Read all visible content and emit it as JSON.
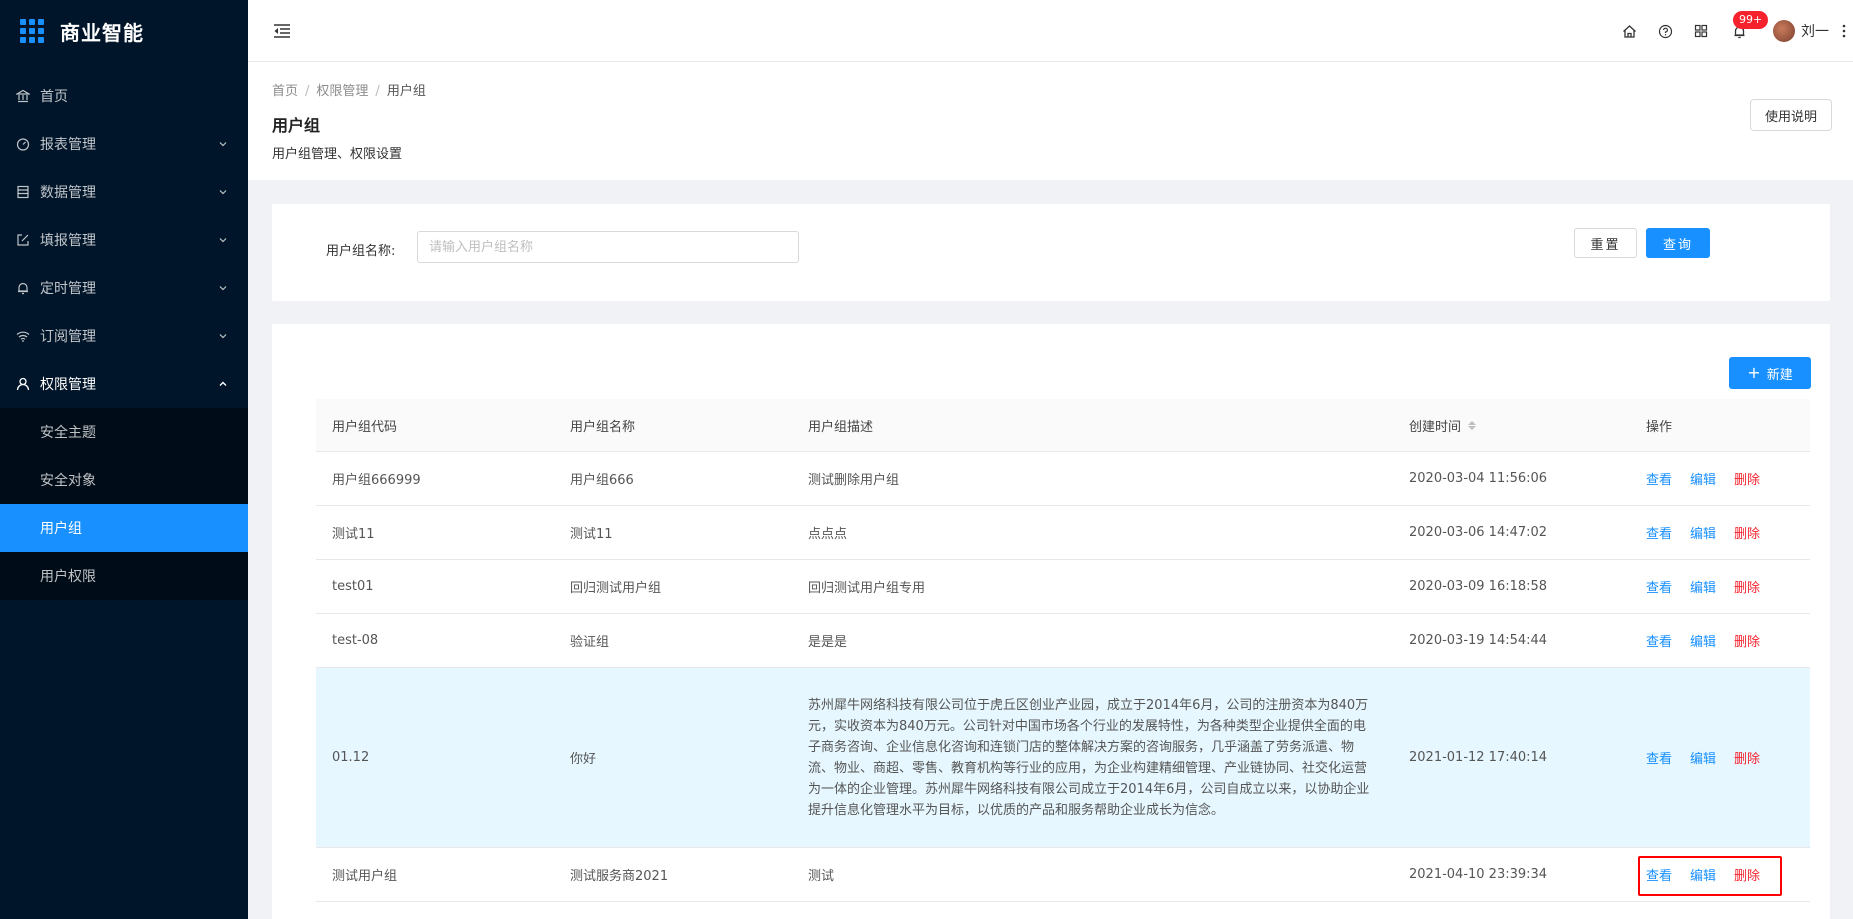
{
  "app": {
    "logo_text": "商业智能"
  },
  "sidebar": {
    "items": [
      {
        "label": "首页",
        "icon": "bank-icon"
      },
      {
        "label": "报表管理",
        "icon": "dashboard-icon"
      },
      {
        "label": "数据管理",
        "icon": "database-icon"
      },
      {
        "label": "填报管理",
        "icon": "form-edit-icon"
      },
      {
        "label": "定时管理",
        "icon": "bell-icon"
      },
      {
        "label": "订阅管理",
        "icon": "wifi-icon"
      },
      {
        "label": "权限管理",
        "icon": "user-icon"
      }
    ],
    "submenu": [
      "安全主题",
      "安全对象",
      "用户组",
      "用户权限"
    ],
    "active_sub": "用户组"
  },
  "header": {
    "badge": "99+",
    "user_name": "刘一"
  },
  "breadcrumb": [
    "首页",
    "权限管理",
    "用户组"
  ],
  "page": {
    "title": "用户组",
    "description": "用户组管理、权限设置",
    "help_button": "使用说明"
  },
  "search": {
    "label": "用户组名称:",
    "placeholder": "请输入用户组名称",
    "value": "",
    "reset_label": "重置",
    "query_label": "查询"
  },
  "table": {
    "new_label": "新建",
    "columns": [
      "用户组代码",
      "用户组名称",
      "用户组描述",
      "创建时间",
      "操作"
    ],
    "actions": {
      "view": "查看",
      "edit": "编辑",
      "delete": "删除"
    },
    "rows": [
      {
        "code": "用户组666999",
        "name": "用户组666",
        "desc": "测试删除用户组",
        "created": "2020-03-04 11:56:06"
      },
      {
        "code": "测试11",
        "name": "测试11",
        "desc": "点点点",
        "created": "2020-03-06 14:47:02"
      },
      {
        "code": "test01",
        "name": "回归测试用户组",
        "desc": "回归测试用户组专用",
        "created": "2020-03-09 16:18:58"
      },
      {
        "code": "test-08",
        "name": "验证组",
        "desc": "是是是",
        "created": "2020-03-19 14:54:44"
      },
      {
        "code": "01.12",
        "name": "你好",
        "desc": "苏州犀牛网络科技有限公司位于虎丘区创业产业园，成立于2014年6月，公司的注册资本为840万元，实收资本为840万元。公司针对中国市场各个行业的发展特性，为各种类型企业提供全面的电子商务咨询、企业信息化咨询和连锁门店的整体解决方案的咨询服务，几乎涵盖了劳务派遣、物流、物业、商超、零售、教育机构等行业的应用，为企业构建精细管理、产业链协同、社交化运营为一体的企业管理。苏州犀牛网络科技有限公司成立于2014年6月，公司自成立以来，以协助企业提升信息化管理水平为目标，以优质的产品和服务帮助企业成长为信念。",
        "created": "2021-01-12 17:40:14"
      },
      {
        "code": "测试用户组",
        "name": "测试服务商2021",
        "desc": "测试",
        "created": "2021-04-10 23:39:34"
      }
    ]
  },
  "colors": {
    "primary": "#1890ff",
    "sidebar_bg": "#001529",
    "danger": "#f5222d"
  }
}
